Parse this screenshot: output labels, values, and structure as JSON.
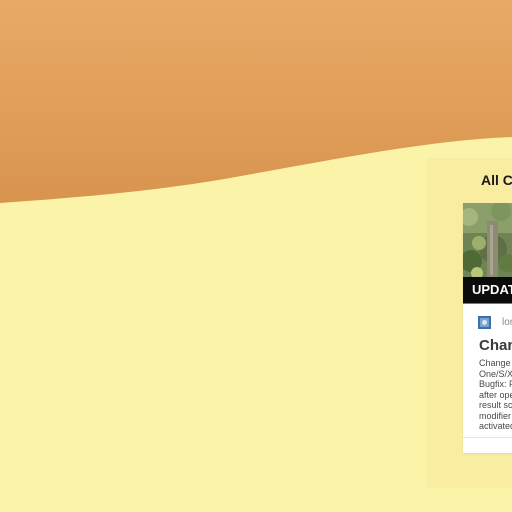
{
  "theme": {
    "hero_top": "#e6a766",
    "hero_bottom": "#d9954e",
    "page_background": "#fbf4a8",
    "panel_background": "#f8eda0"
  },
  "panel": {
    "title": "All Cl"
  },
  "card": {
    "badge": "UPDATE",
    "author": "lor",
    "title": "Chan",
    "excerpt_lines": [
      "Change l",
      "One/S/X",
      "Bugfix: F",
      "after ope",
      "result sc",
      "modifier",
      "activated"
    ]
  }
}
